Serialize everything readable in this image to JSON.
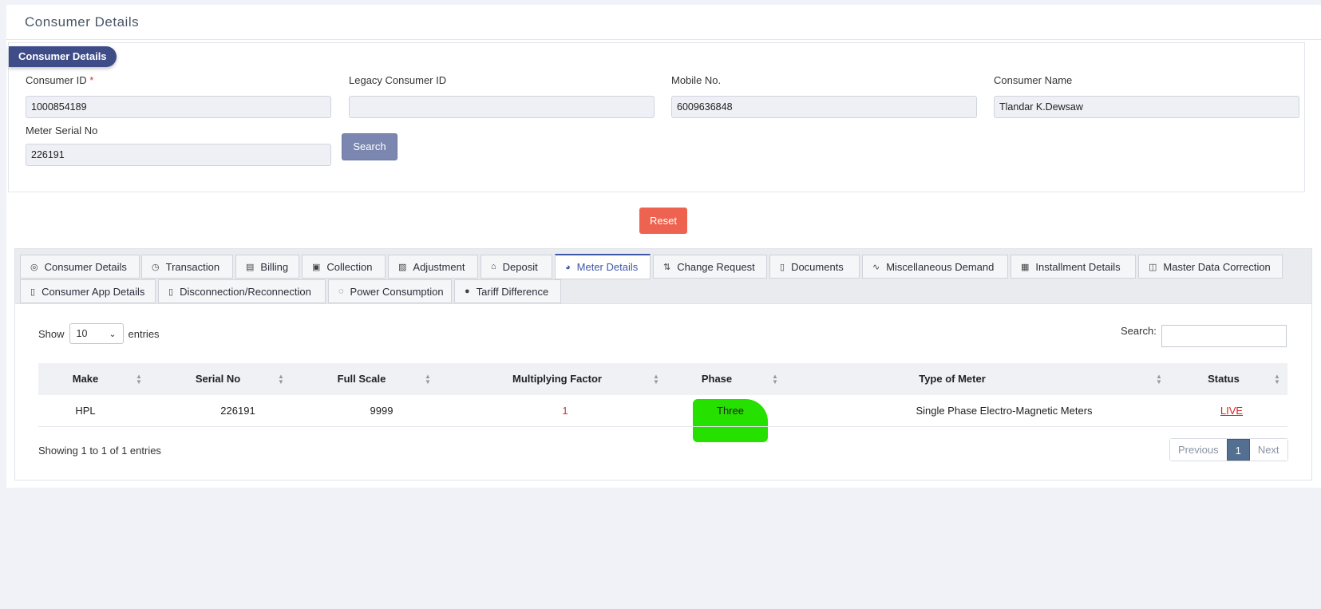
{
  "page_title": "Consumer Details",
  "form": {
    "badge": "Consumer Details",
    "consumer_id_label": "Consumer ID",
    "required_mark": "*",
    "consumer_id_value": "1000854189",
    "legacy_id_label": "Legacy Consumer ID",
    "legacy_id_value": "",
    "mobile_label": "Mobile No.",
    "mobile_value": "6009636848",
    "name_label": "Consumer Name",
    "name_value": "Tlandar K.Dewsaw",
    "meter_serial_label": "Meter Serial No",
    "meter_serial_value": "226191",
    "search_button": "Search",
    "reset_button": "Reset"
  },
  "tabs": [
    {
      "label": "Consumer Details",
      "icon": "target-icon",
      "glyph": "◎"
    },
    {
      "label": "Transaction",
      "icon": "clock-icon",
      "glyph": "◷"
    },
    {
      "label": "Billing",
      "icon": "bill-icon",
      "glyph": "▤"
    },
    {
      "label": "Collection",
      "icon": "list-icon",
      "glyph": "▣"
    },
    {
      "label": "Adjustment",
      "icon": "image-icon",
      "glyph": "▨"
    },
    {
      "label": "Deposit",
      "icon": "bank-icon",
      "glyph": "⌂"
    },
    {
      "label": "Meter Details",
      "icon": "meter-icon",
      "glyph": "◕",
      "active": true
    },
    {
      "label": "Change Request",
      "icon": "swap-icon",
      "glyph": "⇅"
    },
    {
      "label": "Documents",
      "icon": "document-icon",
      "glyph": "▯"
    },
    {
      "label": "Miscellaneous Demand",
      "icon": "pulse-icon",
      "glyph": "∿"
    },
    {
      "label": "Installment Details",
      "icon": "calendar-icon",
      "glyph": "▦"
    },
    {
      "label": "Master Data Correction",
      "icon": "edit-box-icon",
      "glyph": "◫"
    },
    {
      "label": "Consumer App Details",
      "icon": "mobile-icon",
      "glyph": "▯"
    },
    {
      "label": "Disconnection/Reconnection",
      "icon": "mobile-icon",
      "glyph": "▯"
    },
    {
      "label": "Power Consumption",
      "icon": "bulb-icon",
      "glyph": "◌"
    },
    {
      "label": "Tariff Difference",
      "icon": "circle-icon",
      "glyph": "●"
    }
  ],
  "table_controls": {
    "show_label": "Show",
    "entries_value": "10",
    "entries_label": "entries",
    "search_label": "Search:",
    "search_value": ""
  },
  "table": {
    "columns": [
      "Make",
      "Serial No",
      "Full Scale",
      "Multiplying Factor",
      "Phase",
      "Type of Meter",
      "Status"
    ],
    "rows": [
      [
        "HPL",
        "226191",
        "9999",
        "1",
        "Three",
        "Single Phase Electro-Magnetic Meters",
        "LIVE"
      ]
    ]
  },
  "footer": {
    "info": "Showing 1 to 1 of 1 entries",
    "previous": "Previous",
    "current_page": "1",
    "next": "Next"
  },
  "colors": {
    "badge": "#3e4c87",
    "reset": "#ee6350",
    "search": "#7b87b0",
    "active_tab": "#3e57a8",
    "highlight": "#26e000",
    "status_live": "#e02020"
  }
}
